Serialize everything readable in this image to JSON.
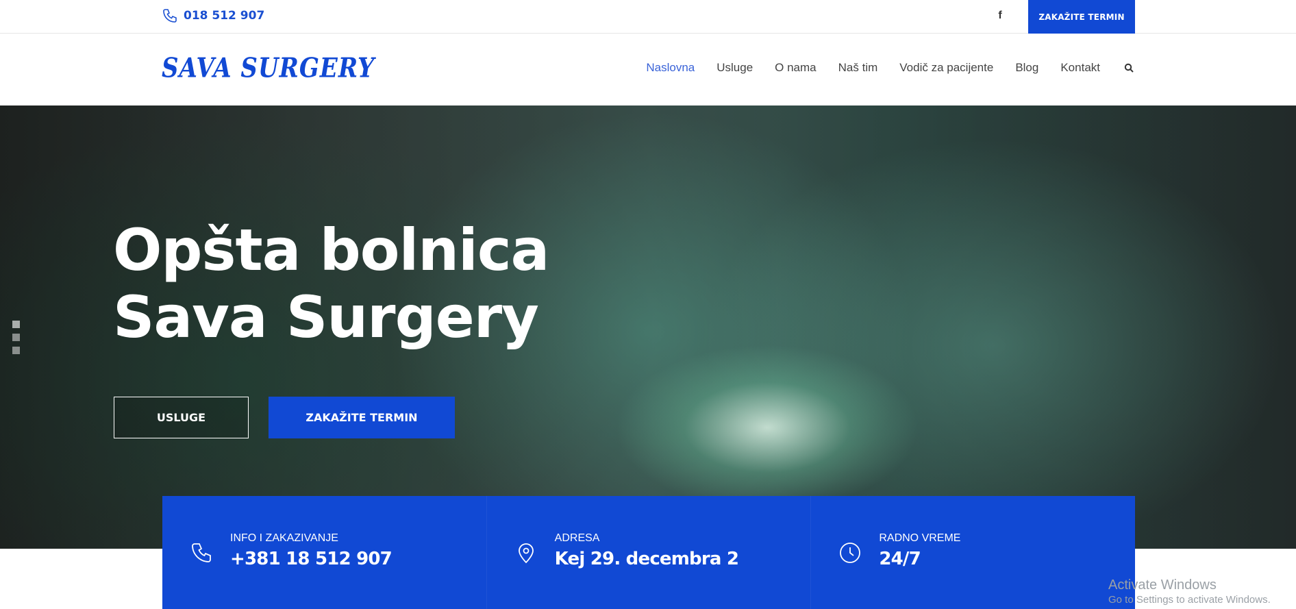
{
  "topbar": {
    "phone": "018 512 907",
    "facebook_glyph": "f",
    "book_button": "ZAKAŽITE TERMIN"
  },
  "header": {
    "logo_text": "SAVA SURGERY",
    "nav": [
      {
        "label": "Naslovna",
        "active": true
      },
      {
        "label": "Usluge"
      },
      {
        "label": "O nama"
      },
      {
        "label": "Naš tim"
      },
      {
        "label": "Vodič za pacijente"
      },
      {
        "label": "Blog"
      },
      {
        "label": "Kontakt"
      }
    ]
  },
  "hero": {
    "title_line1": "Opšta bolnica",
    "title_line2": "Sava Surgery",
    "btn_services": "USLUGE",
    "btn_book": "ZAKAŽITE TERMIN",
    "slider_dots": 3,
    "active_dot": 0
  },
  "info": [
    {
      "icon": "phone-icon",
      "label": "INFO I ZAKAZIVANJE",
      "value": "+381 18 512 907"
    },
    {
      "icon": "location-pin-icon",
      "label": "ADRESA",
      "value": "Kej 29. decembra 2"
    },
    {
      "icon": "clock-icon",
      "label": "RADNO VREME",
      "value": "24/7"
    }
  ],
  "watermark": {
    "line1": "Activate Windows",
    "line2": "Go to Settings to activate Windows."
  },
  "colors": {
    "brand_blue": "#1149d4",
    "nav_active": "#3a63d8"
  }
}
